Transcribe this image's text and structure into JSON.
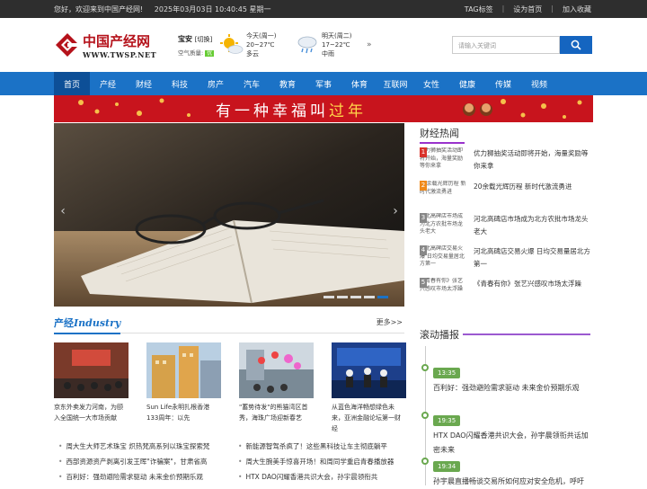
{
  "topbar": {
    "welcome": "您好，欢迎来到中国产经网!",
    "datetime": "2025年03月03日 10:40:45 星期一",
    "links": [
      "TAG标签",
      "设为首页",
      "加入收藏"
    ]
  },
  "logo": {
    "cn": "中国产经网",
    "en": "WWW.TWSP.NET"
  },
  "weather": {
    "city": "宝安",
    "city_tag": "[切换]",
    "air_label": "空气质量:",
    "air_value": "优",
    "today": {
      "day": "今天(周一)",
      "temp": "20~27℃",
      "desc": "多云",
      "icon": "partly-cloudy-icon"
    },
    "tomorrow": {
      "day": "明天(周二)",
      "temp": "17~22℃",
      "desc": "中雨",
      "icon": "rain-icon"
    },
    "more": "»"
  },
  "search": {
    "placeholder": "请输入关键词",
    "button_icon": "search-icon"
  },
  "nav": [
    "首页",
    "产经",
    "财经",
    "科技",
    "房产",
    "汽车",
    "教育",
    "军事",
    "体育",
    "互联网",
    "女性",
    "健康",
    "传媒",
    "视频"
  ],
  "banner": {
    "slogan_pre": "有一种幸福叫",
    "slogan_gold": "过年"
  },
  "slider": {
    "prev": "‹",
    "next": "›",
    "dots": 5
  },
  "section": {
    "title_cn": "产经",
    "title_en": "Industry",
    "more": "更多>>"
  },
  "cards": [
    {
      "caption": "京东外卖发力河南，为颐入全国统一大市场贡献"
    },
    {
      "caption": "Sun Life永明扎根香港133周年：以先"
    },
    {
      "caption": "\"蓄势待发\"的熊猫湾区首秀，海珠广场迎新春艺"
    },
    {
      "caption": "从蓝色海洋畅想绿色未来，亚洲金融论坛第一财经"
    }
  ],
  "news_left": [
    "周大生大师艺术珠宝 炽热梵高系列以珠宝探索梵",
    "西部资源资产剥离引发王晖\"诈骗案\"，甘肃省高",
    "百利好：强劲避险需求驱动 未来金价预期乐观"
  ],
  "news_right": [
    "新能源智驾杀疯了！这些黑科技让车主彻底躺平",
    "周大生腕美手惊喜开场！和周同学重启青春播放器",
    "HTX DAO闪耀香港共识大会，孙宇晨领衔共"
  ],
  "hot": {
    "title": "财经热闻",
    "items": [
      {
        "num": "1",
        "thumb": "优力狮抽奖活动即将开始，海量奖励等你来拿",
        "text": "优力狮抽奖活动即将开始，海量奖励等你来拿"
      },
      {
        "num": "2",
        "thumb": "20余载光辉历程 新时代激流勇进",
        "text": "20余载光辉历程 新时代激流勇进"
      },
      {
        "num": "3",
        "thumb": "河北高碑店市场成为北方农批市场龙头老大",
        "text": "河北高碑店市场成为北方农批市场龙头老大"
      },
      {
        "num": "4",
        "thumb": "河北高碑店交易火爆 日均交易量居北方第一",
        "text": "河北高碑店交易火爆 日均交易量居北方第一"
      },
      {
        "num": "5",
        "thumb": "《青春有你》张艺兴感叹市场太浮躁",
        "text": "《青春有你》张艺兴感叹市场太浮躁"
      }
    ]
  },
  "roll": {
    "title": "滚动播报",
    "items": [
      {
        "time": "13:35",
        "text": "百利好：强劲避险需求驱动 未来金价预期乐观"
      },
      {
        "time": "19:35",
        "text": "HTX DAO闪耀香港共识大会，孙宇晨领衔共话加密未来"
      },
      {
        "time": "19:34",
        "text": "孙宇晨直播畅谈交易所如何应对安全危机，呼吁"
      }
    ]
  },
  "colors": {
    "nav": "#1b72c6",
    "nav_active": "#0d4f97",
    "banner": "#c8141d",
    "accent_purple": "#9b59d0",
    "time_green": "#6aa84f"
  }
}
